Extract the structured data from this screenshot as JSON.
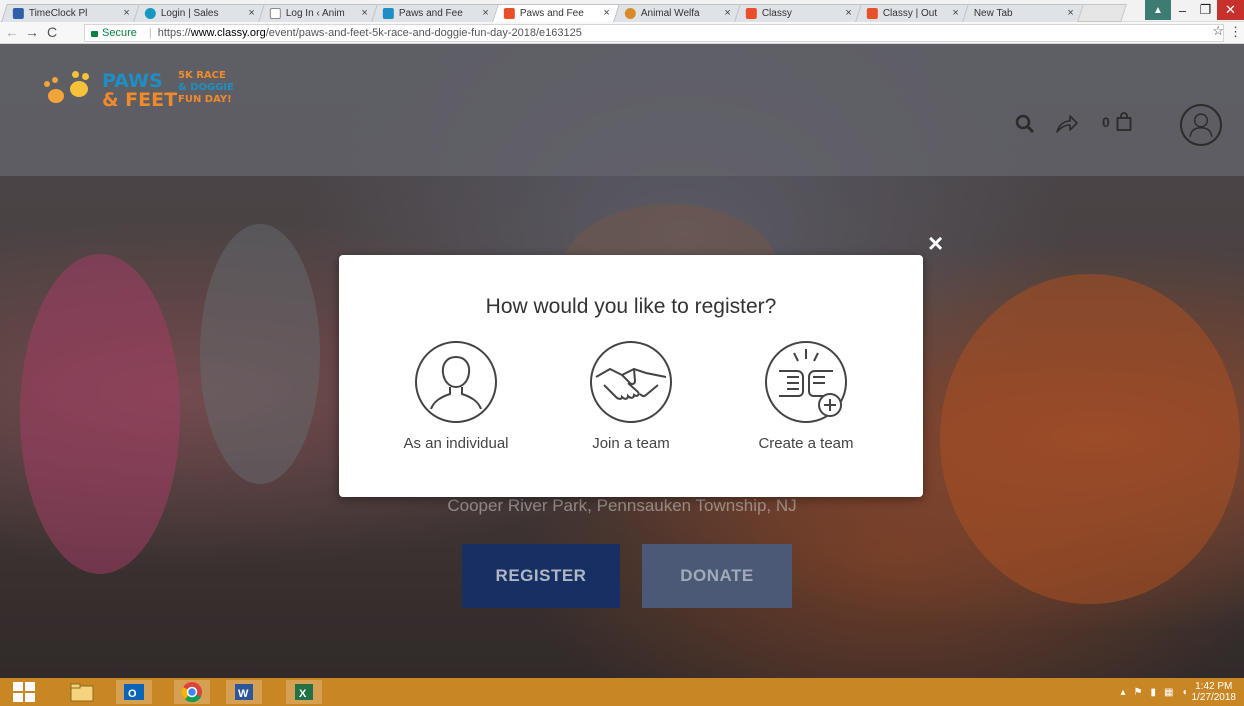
{
  "browser": {
    "tabs": [
      {
        "label": "TimeClock Pl",
        "color": "#2f5fa8"
      },
      {
        "label": "Login | Sales",
        "color": "#1798c1"
      },
      {
        "label": "Log In ‹ Anim",
        "color": "#888888"
      },
      {
        "label": "Paws and Fee",
        "color": "#1f8ec3"
      },
      {
        "label": "Paws and Fee",
        "color": "#e8502b",
        "active": true
      },
      {
        "label": "Animal Welfa",
        "color": "#d98b2b"
      },
      {
        "label": "Classy",
        "color": "#e8502b"
      },
      {
        "label": "Classy | Out",
        "color": "#e8502b"
      },
      {
        "label": "New Tab",
        "color": "#ffffff"
      }
    ],
    "tab_close_glyph": "×",
    "secure_label": "Secure",
    "url_scheme": "https://",
    "url_host": "www.classy.org",
    "url_path": "/event/paws-and-feet-5k-race-and-doggie-fun-day-2018/e163125"
  },
  "header": {
    "logo_line1": "PAWS",
    "logo_line2": "& FEET",
    "logo_side1": "5K RACE",
    "logo_side2": "& DOGGIE",
    "logo_side3": "FUN DAY!",
    "cart_count": "0"
  },
  "hero": {
    "location": "Cooper River Park, Pennsauken Township, NJ",
    "register_label": "REGISTER",
    "donate_label": "DONATE"
  },
  "modal": {
    "title": "How would you like to register?",
    "options": [
      {
        "label": "As an individual",
        "icon": "person-icon"
      },
      {
        "label": "Join a team",
        "icon": "handshake-icon"
      },
      {
        "label": "Create a team",
        "icon": "fist-bump-plus-icon"
      }
    ],
    "close_glyph": "×"
  },
  "taskbar": {
    "clock_time": "1:42 PM",
    "clock_date": "1/27/2018"
  },
  "colors": {
    "register_bg": "#1d3a78",
    "donate_bg": "#5c6d92",
    "taskbar": "#c98625"
  }
}
